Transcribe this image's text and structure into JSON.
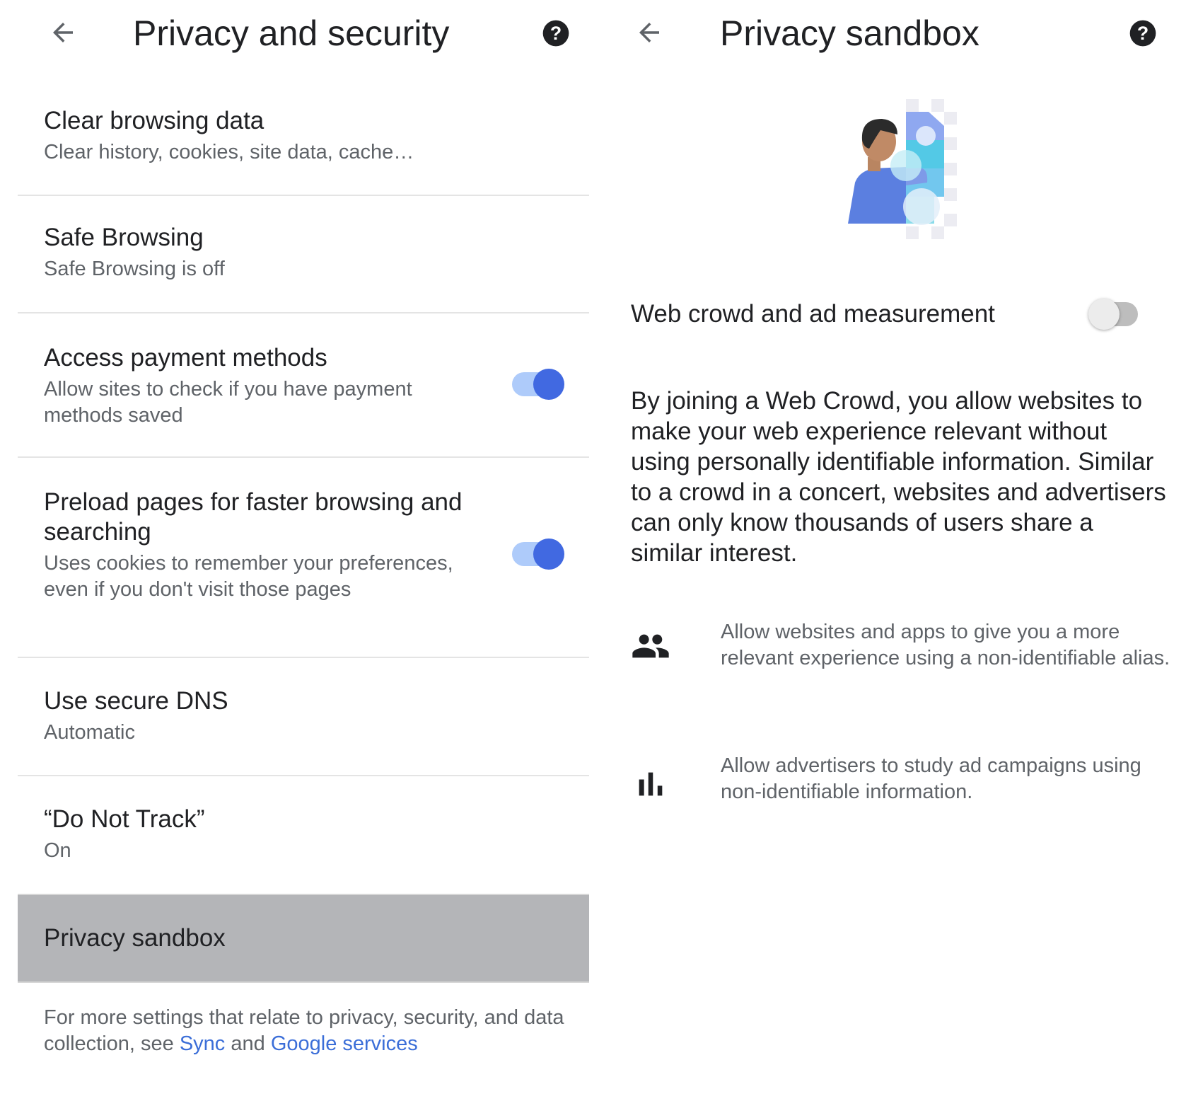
{
  "left_panel": {
    "title": "Privacy and security",
    "back_icon": "arrow-back-icon",
    "help_icon": "help-icon",
    "settings": [
      {
        "title": "Clear browsing data",
        "summary": "Clear history, cookies, site data, cache…"
      },
      {
        "title": "Safe Browsing",
        "summary": "Safe Browsing is off"
      },
      {
        "title": "Access payment methods",
        "summary": "Allow sites to check if you have payment methods saved",
        "toggle": "on"
      },
      {
        "title": "Preload pages for faster browsing and searching",
        "summary": "Uses cookies to remember your preferences, even if you don't visit those pages",
        "toggle": "on"
      },
      {
        "title": "Use secure DNS",
        "summary": "Automatic"
      },
      {
        "title": "“Do Not Track”",
        "summary": "On"
      },
      {
        "title": "Privacy sandbox",
        "selected": true
      }
    ],
    "footer": {
      "text_before": "For more settings that relate to privacy, security, and data collection, see ",
      "link1": "Sync",
      "text_between": " and ",
      "link2": "Google services"
    }
  },
  "right_panel": {
    "title": "Privacy sandbox",
    "back_icon": "arrow-back-icon",
    "help_icon": "help-icon",
    "illustration": "privacy-sandbox-illustration",
    "toggle_label": "Web crowd and ad measurement",
    "toggle_state": "off",
    "description": "By joining a Web Crowd, you allow websites to make your web experience relevant without using personally identifiable information. Similar to a crowd in a concert, websites and advertisers can only know thousands of users share a similar interest.",
    "features": [
      {
        "icon": "people-icon",
        "text": "Allow websites and apps to give you a more relevant experience using a non-identifiable alias."
      },
      {
        "icon": "bar-chart-icon",
        "text": "Allow advertisers to study ad campaigns using non-identifiable information."
      }
    ]
  },
  "colors": {
    "accent": "#4169e1",
    "link": "#3b6ed8",
    "selected_row": "#b4b5b8",
    "secondary_text": "#5f6368"
  }
}
